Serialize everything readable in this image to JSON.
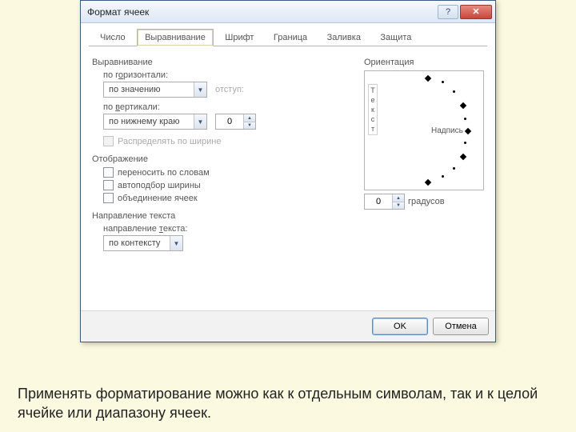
{
  "window": {
    "title": "Формат ячеек",
    "help": "?",
    "close": "✕"
  },
  "tabs": [
    "Число",
    "Выравнивание",
    "Шрифт",
    "Граница",
    "Заливка",
    "Защита"
  ],
  "align": {
    "group": "Выравнивание",
    "horiz_label": "по горизонтали:",
    "horiz_value": "по значению",
    "vert_label": "по вертикали:",
    "vert_value": "по нижнему краю",
    "indent_label": "отступ:",
    "indent_value": "0",
    "distribute": "Распределять по ширине"
  },
  "display": {
    "group": "Отображение",
    "wrap": "переносить по словам",
    "shrink": "автоподбор ширины",
    "merge": "объединение ячеек"
  },
  "direction": {
    "group": "Направление текста",
    "label": "направление текста:",
    "value": "по контексту"
  },
  "orient": {
    "group": "Ориентация",
    "v_chars": [
      "Т",
      "е",
      "к",
      "с",
      "т"
    ],
    "nadpis": "Надпись",
    "deg_value": "0",
    "deg_label": "градусов"
  },
  "footer": {
    "ok": "OK",
    "cancel": "Отмена"
  },
  "caption": "Применять форматирование можно как к отдельным символам, так и к целой ячейке или диапазону ячеек."
}
